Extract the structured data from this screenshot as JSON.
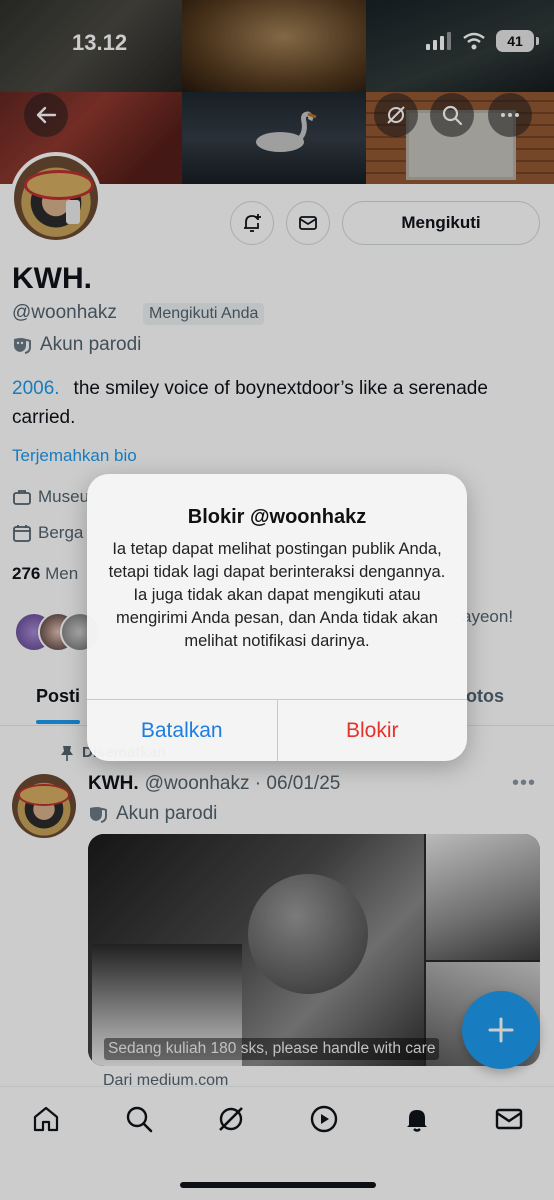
{
  "status_bar": {
    "time": "13.12",
    "battery": "41"
  },
  "profile": {
    "name": "KWH.",
    "handle": "@woonhakz",
    "follows_you_badge": "Mengikuti Anda",
    "parody_label": "Akun parodi",
    "bio_link": "2006.",
    "bio_text": "the smiley voice of boynextdoor’s like a serenade carried.",
    "translate_bio": "Terjemahkan bio",
    "meta_location_partial": "Museu",
    "meta_joined_partial": "Berga",
    "following_count": "276",
    "following_label_partial": "Men",
    "mutual_text_partial": "ayeon!",
    "follow_button": "Mengikuti"
  },
  "tabs": {
    "posts_partial": "Posti",
    "photos_partial": "otos"
  },
  "pinned_post": {
    "pinned_label": "Disematkan",
    "author_name": "KWH.",
    "author_handle_date": "@woonhakz · 06/01/25",
    "parody_label": "Akun parodi",
    "media_caption": "Sedang kuliah 180 sks, please handle with care",
    "source": "Dari medium.com"
  },
  "dialog": {
    "title": "Blokir @woonhakz",
    "message": "Ia tetap dapat melihat postingan publik Anda, tetapi tidak lagi dapat berinteraksi dengannya. Ia juga tidak akan dapat mengikuti atau mengirimi Anda pesan, dan Anda tidak akan melihat notifikasi darinya.",
    "cancel_label": "Batalkan",
    "confirm_label": "Blokir"
  },
  "colors": {
    "accent": "#1d9bf0",
    "destructive": "#e5322c",
    "ios_blue": "#1d7ee0"
  },
  "icons": [
    "back-arrow-icon",
    "grok-icon",
    "search-icon",
    "more-icon",
    "notification-add-icon",
    "mail-icon",
    "mask-icon",
    "briefcase-icon",
    "calendar-icon",
    "pin-icon",
    "plus-icon",
    "home-icon",
    "play-icon",
    "bell-icon"
  ]
}
